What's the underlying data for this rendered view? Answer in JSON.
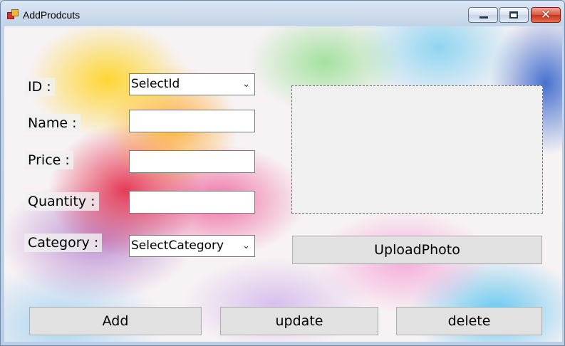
{
  "window": {
    "title": "AddProdcuts",
    "close_glyph": "✕"
  },
  "labels": {
    "id": "ID :",
    "name": "Name :",
    "price": "Price :",
    "quantity": "Quantity :",
    "category": "Category :"
  },
  "fields": {
    "id_combo": "SelectId",
    "name_value": "",
    "price_value": "",
    "quantity_value": "",
    "category_combo": "SelectCategory",
    "chevron": "⌄"
  },
  "buttons": {
    "upload": "UploadPhoto",
    "add": "Add",
    "update": "update",
    "delete": "delete"
  }
}
